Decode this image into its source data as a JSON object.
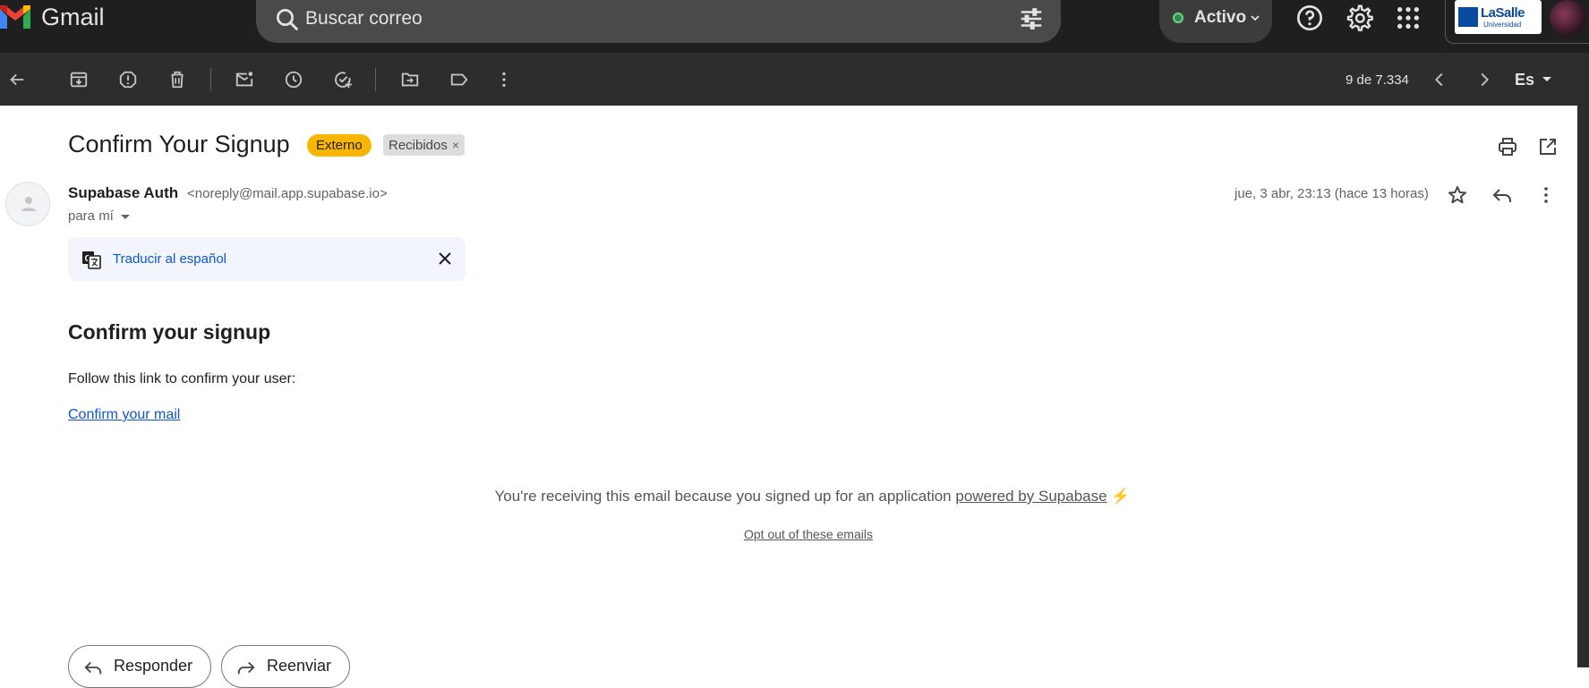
{
  "app": {
    "name": "Gmail"
  },
  "search": {
    "placeholder": "Buscar correo"
  },
  "status": {
    "label": "Activo",
    "color": "#6dd58c"
  },
  "account": {
    "org_name": "LaSalle",
    "org_subtitle": "Universidad"
  },
  "toolbar": {
    "icons": [
      "back-arrow-icon",
      "archive-icon",
      "report-spam-icon",
      "delete-icon",
      "mark-unread-icon",
      "snooze-icon",
      "add-task-icon",
      "move-to-icon",
      "label-icon",
      "more-vert-icon"
    ],
    "count": "9 de 7.334",
    "language": "Es"
  },
  "email": {
    "subject": "Confirm Your Signup",
    "label_external": "Externo",
    "label_inbox": "Recibidos",
    "sender_name": "Supabase Auth",
    "sender_email": "<noreply@mail.app.supabase.io>",
    "to": "para mí",
    "date": "jue, 3 abr, 23:13 (hace 13 horas)",
    "translate_link": "Traducir al español",
    "body_title": "Confirm your signup",
    "body_text": "Follow this link to confirm your user:",
    "body_link": "Confirm your mail",
    "footer_prefix": "You're receiving this email because you signed up for an application ",
    "footer_link": "powered by Supabase",
    "footer_emoji": "⚡",
    "optout": "Opt out of these emails"
  },
  "actions": {
    "reply": "Responder",
    "forward": "Reenviar"
  },
  "colors": {
    "topbar": "#1f1f1f",
    "toolbar": "#2d2d2d",
    "external_label": "#f9b600",
    "link": "#1155cc"
  }
}
